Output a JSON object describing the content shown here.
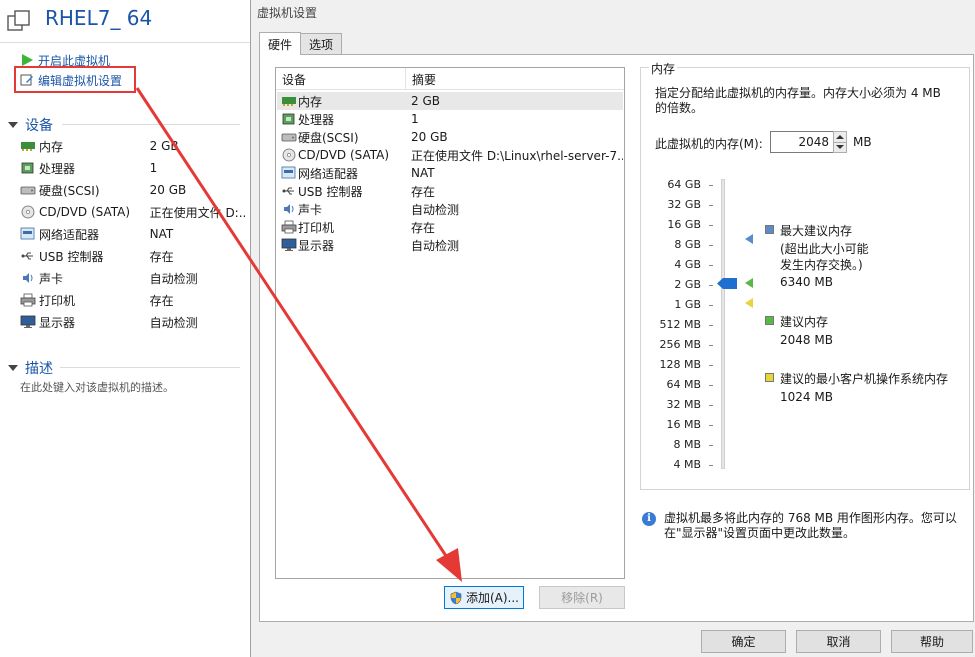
{
  "vm": {
    "title": "RHEL7_ 64",
    "power_on_label": "开启此虚拟机",
    "edit_settings_label": "编辑虚拟机设置"
  },
  "sidebar": {
    "devices_heading": "设备",
    "devices": [
      {
        "icon": "memory-icon",
        "name": "内存",
        "value": "2 GB"
      },
      {
        "icon": "cpu-icon",
        "name": "处理器",
        "value": "1"
      },
      {
        "icon": "harddisk-icon",
        "name": "硬盘(SCSI)",
        "value": "20 GB"
      },
      {
        "icon": "cdrom-icon",
        "name": "CD/DVD (SATA)",
        "value": "正在使用文件 D:..."
      },
      {
        "icon": "network-icon",
        "name": "网络适配器",
        "value": "NAT"
      },
      {
        "icon": "usb-icon",
        "name": "USB 控制器",
        "value": "存在"
      },
      {
        "icon": "sound-icon",
        "name": "声卡",
        "value": "自动检测"
      },
      {
        "icon": "printer-icon",
        "name": "打印机",
        "value": "存在"
      },
      {
        "icon": "display-icon",
        "name": "显示器",
        "value": "自动检测"
      }
    ],
    "description_heading": "描述",
    "description_placeholder": "在此处键入对该虚拟机的描述。"
  },
  "dialog": {
    "title": "虚拟机设置",
    "tabs": [
      {
        "label": "硬件",
        "active": true
      },
      {
        "label": "选项",
        "active": false
      }
    ],
    "list_header": {
      "device": "设备",
      "summary": "摘要"
    },
    "devices": [
      {
        "icon": "memory-icon",
        "name": "内存",
        "summary": "2 GB",
        "selected": true
      },
      {
        "icon": "cpu-icon",
        "name": "处理器",
        "summary": "1"
      },
      {
        "icon": "harddisk-icon",
        "name": "硬盘(SCSI)",
        "summary": "20 GB"
      },
      {
        "icon": "cdrom-icon",
        "name": "CD/DVD (SATA)",
        "summary": "正在使用文件 D:\\Linux\\rhel-server-7..."
      },
      {
        "icon": "network-icon",
        "name": "网络适配器",
        "summary": "NAT"
      },
      {
        "icon": "usb-icon",
        "name": "USB 控制器",
        "summary": "存在"
      },
      {
        "icon": "sound-icon",
        "name": "声卡",
        "summary": "自动检测"
      },
      {
        "icon": "printer-icon",
        "name": "打印机",
        "summary": "存在"
      },
      {
        "icon": "display-icon",
        "name": "显示器",
        "summary": "自动检测"
      }
    ],
    "add_button": "添加(A)...",
    "remove_button": "移除(R)",
    "memory": {
      "group_label": "内存",
      "description": "指定分配给此虚拟机的内存量。内存大小必须为 4 MB 的倍数。",
      "field_label": "此虚拟机的内存(M):",
      "value": "2048",
      "unit": "MB",
      "scale": [
        "64 GB",
        "32 GB",
        "16 GB",
        "8 GB",
        "4 GB",
        "2 GB",
        "1 GB",
        "512 MB",
        "256 MB",
        "128 MB",
        "64 MB",
        "32 MB",
        "16 MB",
        "8 MB",
        "4 MB"
      ],
      "legend": {
        "max_label": "最大建议内存",
        "max_note_1": "(超出此大小可能",
        "max_note_2": "发生内存交换。)",
        "max_value": "6340 MB",
        "rec_label": "建议内存",
        "rec_value": "2048 MB",
        "min_label": "建议的最小客户机操作系统内存",
        "min_value": "1024 MB"
      },
      "colors": {
        "max": "#5b8cc8",
        "recommended": "#58b845",
        "min": "#e8d53c",
        "thumb": "#1f6fd1"
      },
      "info_text": "虚拟机最多将此内存的 768 MB 用作图形内存。您可以在\"显示器\"设置页面中更改此数量。"
    },
    "ok_button": "确定",
    "cancel_button": "取消",
    "help_button": "帮助"
  },
  "annotation": {
    "color": "#e53935"
  }
}
